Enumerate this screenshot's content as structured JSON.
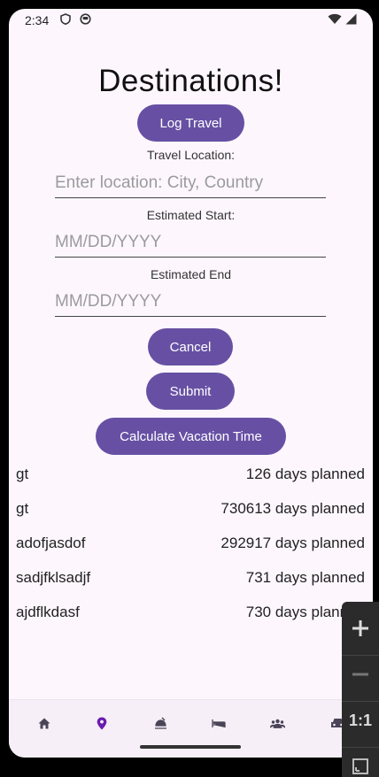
{
  "status_bar": {
    "time": "2:34",
    "left_icons": [
      "shield-icon",
      "face-icon"
    ],
    "right_icons": [
      "wifi-icon",
      "signal-icon"
    ]
  },
  "page": {
    "title": "Destinations!"
  },
  "buttons": {
    "log_travel": "Log Travel",
    "cancel": "Cancel",
    "submit": "Submit",
    "calculate": "Calculate Vacation Time"
  },
  "form": {
    "location_label": "Travel Location:",
    "location_placeholder": "Enter location: City, Country",
    "location_value": "",
    "start_label": "Estimated Start:",
    "start_placeholder": "MM/DD/YYYY",
    "start_value": "",
    "end_label": "Estimated End",
    "end_placeholder": "MM/DD/YYYY",
    "end_value": ""
  },
  "trips": [
    {
      "name": "gt",
      "days": "126 days planned"
    },
    {
      "name": "gt",
      "days": "730613 days planned"
    },
    {
      "name": "adofjasdof",
      "days": "292917 days planned"
    },
    {
      "name": "sadjfklsadjf",
      "days": "731 days planned"
    },
    {
      "name": "ajdflkdasf",
      "days": "730 days planned"
    }
  ],
  "bottom_nav": {
    "items": [
      "home-icon",
      "location-pin-icon",
      "restaurant-icon",
      "hotel-bed-icon",
      "group-icon",
      "car-icon"
    ],
    "active_index": 1
  },
  "zoom_panel": {
    "ratio_label": "1:1"
  },
  "colors": {
    "accent": "#6750a4",
    "background": "#fdf7fd",
    "nav_active": "#6a1bb0",
    "nav_inactive": "#4a4458"
  }
}
